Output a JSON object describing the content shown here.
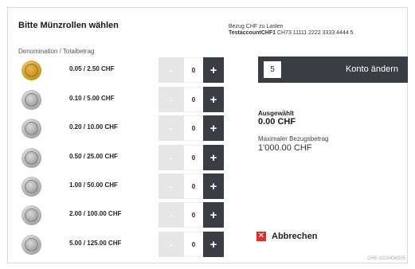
{
  "page": {
    "title": "Bitte Münzrollen wählen",
    "column_header": "Denomination / Totalbetrag"
  },
  "account": {
    "line1": "Bezug CHF zu Lasten",
    "name": "TestaccountCHF1",
    "iban": "CH73 11111 2222 3333 4444 5"
  },
  "rows": [
    {
      "label": "0.05 / 2.50 CHF",
      "coin": "gold-coin-icon",
      "qty": "0",
      "minus": "-",
      "plus": "+"
    },
    {
      "label": "0.10 / 5.00 CHF",
      "coin": "silver-coin-icon",
      "qty": "0",
      "minus": "-",
      "plus": "+"
    },
    {
      "label": "0.20 / 10.00 CHF",
      "coin": "silver-coin-icon",
      "qty": "0",
      "minus": "-",
      "plus": "+"
    },
    {
      "label": "0.50 / 25.00 CHF",
      "coin": "silver-coin-icon",
      "qty": "0",
      "minus": "-",
      "plus": "+"
    },
    {
      "label": "1.00 / 50.00 CHF",
      "coin": "silver-coin-icon",
      "qty": "0",
      "minus": "-",
      "plus": "+"
    },
    {
      "label": "2.00 / 100.00 CHF",
      "coin": "silver-coin-icon",
      "qty": "0",
      "minus": "-",
      "plus": "+"
    },
    {
      "label": "5.00 / 125.00 CHF",
      "coin": "silver-coin-icon",
      "qty": "0",
      "minus": "-",
      "plus": "+"
    }
  ],
  "konto": {
    "number": "5",
    "label": "Konto ändern"
  },
  "summary": {
    "selected_label": "Ausgewählt",
    "selected_value": "0.00 CHF",
    "max_label": "Maximaler Bezugsbetrag",
    "max_value": "1'000.00 CHF"
  },
  "cancel": {
    "icon": "close-icon",
    "label": "Abbrechen"
  },
  "footer": {
    "id": "CHE-1223434325"
  },
  "colors": {
    "dark_button": "#3a3e43",
    "disabled_button": "#e6e6e6",
    "cancel_red": "#d9312b"
  }
}
